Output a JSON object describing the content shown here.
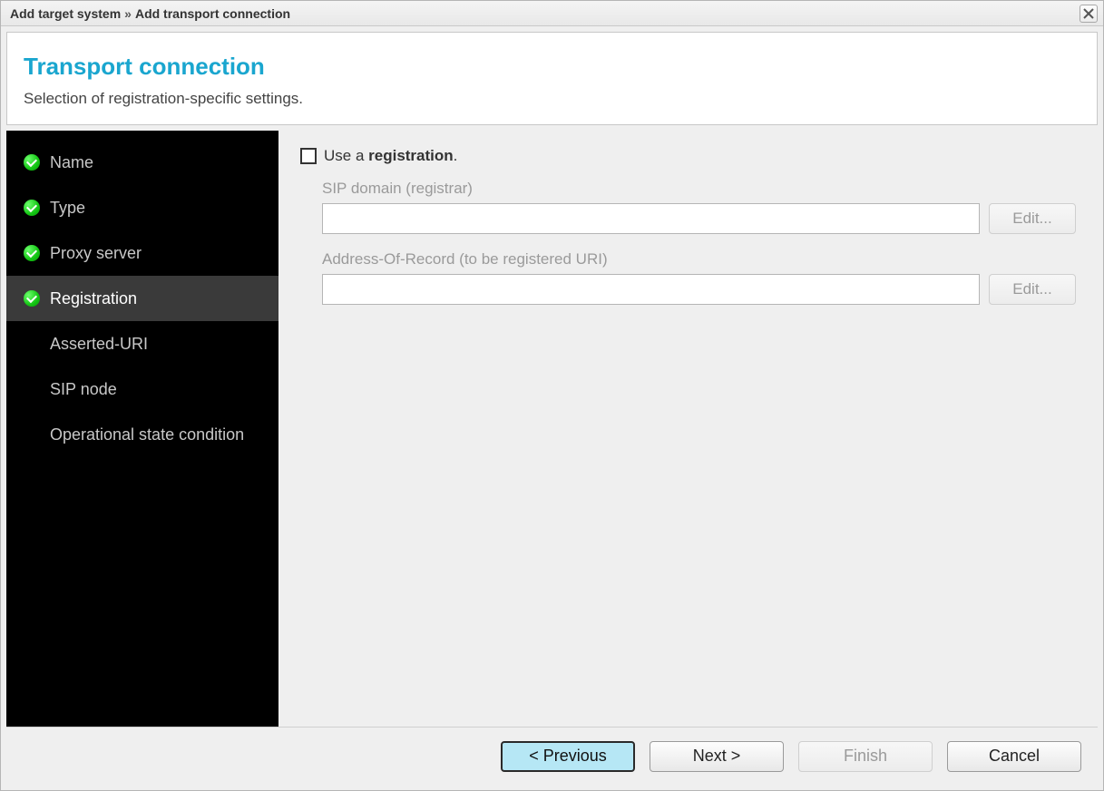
{
  "titlebar": {
    "crumb1": "Add target system",
    "separator": "»",
    "crumb2": "Add transport connection"
  },
  "header": {
    "title": "Transport connection",
    "subtitle": "Selection of registration-specific settings."
  },
  "sidebar": {
    "steps": [
      {
        "label": "Name",
        "done": true,
        "active": false
      },
      {
        "label": "Type",
        "done": true,
        "active": false
      },
      {
        "label": "Proxy server",
        "done": true,
        "active": false
      },
      {
        "label": "Registration",
        "done": true,
        "active": true
      },
      {
        "label": "Asserted-URI",
        "done": false,
        "active": false
      },
      {
        "label": "SIP node",
        "done": false,
        "active": false
      },
      {
        "label": "Operational state condition",
        "done": false,
        "active": false
      }
    ]
  },
  "form": {
    "use_registration_prefix": "Use a ",
    "use_registration_bold": "registration",
    "use_registration_suffix": ".",
    "use_registration_checked": false,
    "fields": [
      {
        "label": "SIP domain (registrar)",
        "value": "",
        "edit_label": "Edit..."
      },
      {
        "label": "Address-Of-Record (to be registered URI)",
        "value": "",
        "edit_label": "Edit..."
      }
    ]
  },
  "footer": {
    "previous": "< Previous",
    "next": "Next >",
    "finish": "Finish",
    "cancel": "Cancel",
    "finish_enabled": false
  }
}
